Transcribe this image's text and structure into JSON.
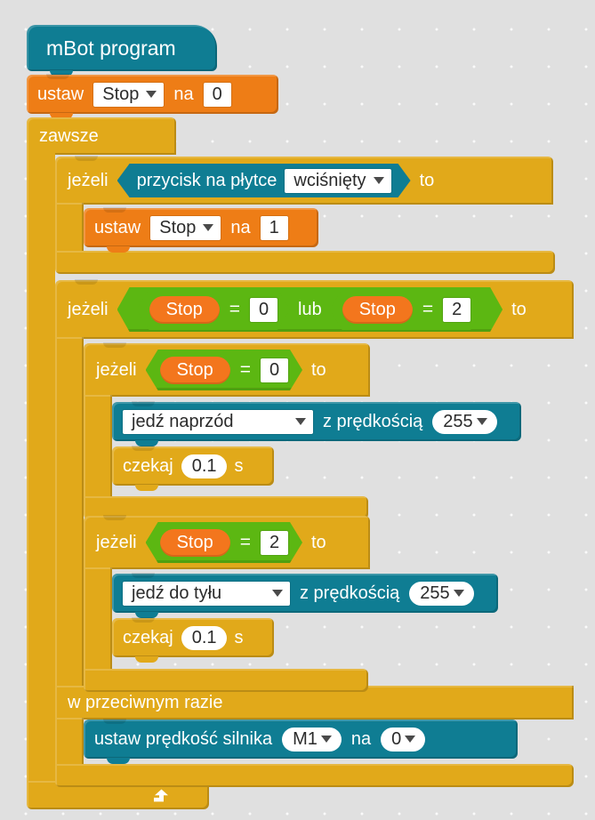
{
  "app": {
    "name": "mBlock block editor",
    "language": "pl",
    "canvas_background": "#e0e0e0"
  },
  "palette": {
    "hat_teal": "#0f7d93",
    "robot_teal": "#0f7d93",
    "variable_orange": "#ee7d16",
    "reporter_orange": "#f3761d",
    "control_gold": "#e1a91a",
    "operator_green": "#5cb712",
    "input_white": "#ffffff",
    "text_white": "#ffffff",
    "text_dark": "#2b2b2b"
  },
  "script": {
    "hat": {
      "label": "mBot program"
    },
    "set_stop_0": {
      "verb": "ustaw",
      "variable": "Stop",
      "connector": "na",
      "value": "0"
    },
    "forever": {
      "label": "zawsze"
    },
    "if_button": {
      "keyword": "jeżeli",
      "then": "to",
      "condition": {
        "text_before": "przycisk na płytce",
        "state": "wciśnięty"
      },
      "body": {
        "set_stop_1": {
          "verb": "ustaw",
          "variable": "Stop",
          "connector": "na",
          "value": "1"
        }
      }
    },
    "if_else_main": {
      "keyword": "jeżeli",
      "then": "to",
      "else_label": "w przeciwnym razie",
      "condition": {
        "operator": "lub",
        "left": {
          "variable": "Stop",
          "comparator": "=",
          "value": "0"
        },
        "right": {
          "variable": "Stop",
          "comparator": "=",
          "value": "2"
        }
      },
      "body": {
        "if_forward": {
          "keyword": "jeżeli",
          "then": "to",
          "condition": {
            "variable": "Stop",
            "comparator": "=",
            "value": "0"
          },
          "body": {
            "drive": {
              "direction": "jedź naprzód",
              "connector": "z prędkością",
              "speed": "255"
            },
            "wait": {
              "verb": "czekaj",
              "value": "0.1",
              "unit": "s"
            }
          }
        },
        "if_backward": {
          "keyword": "jeżeli",
          "then": "to",
          "condition": {
            "variable": "Stop",
            "comparator": "=",
            "value": "2"
          },
          "body": {
            "drive": {
              "direction": "jedź do tyłu",
              "connector": "z prędkością",
              "speed": "255"
            },
            "wait": {
              "verb": "czekaj",
              "value": "0.1",
              "unit": "s"
            }
          }
        }
      },
      "else_body": {
        "motor": {
          "verb": "ustaw prędkość silnika",
          "motor_port": "M1",
          "connector": "na",
          "value": "0"
        }
      }
    }
  },
  "icons": {
    "dropdown": "chevron-down-icon",
    "loop": "loop-arrow-icon"
  }
}
